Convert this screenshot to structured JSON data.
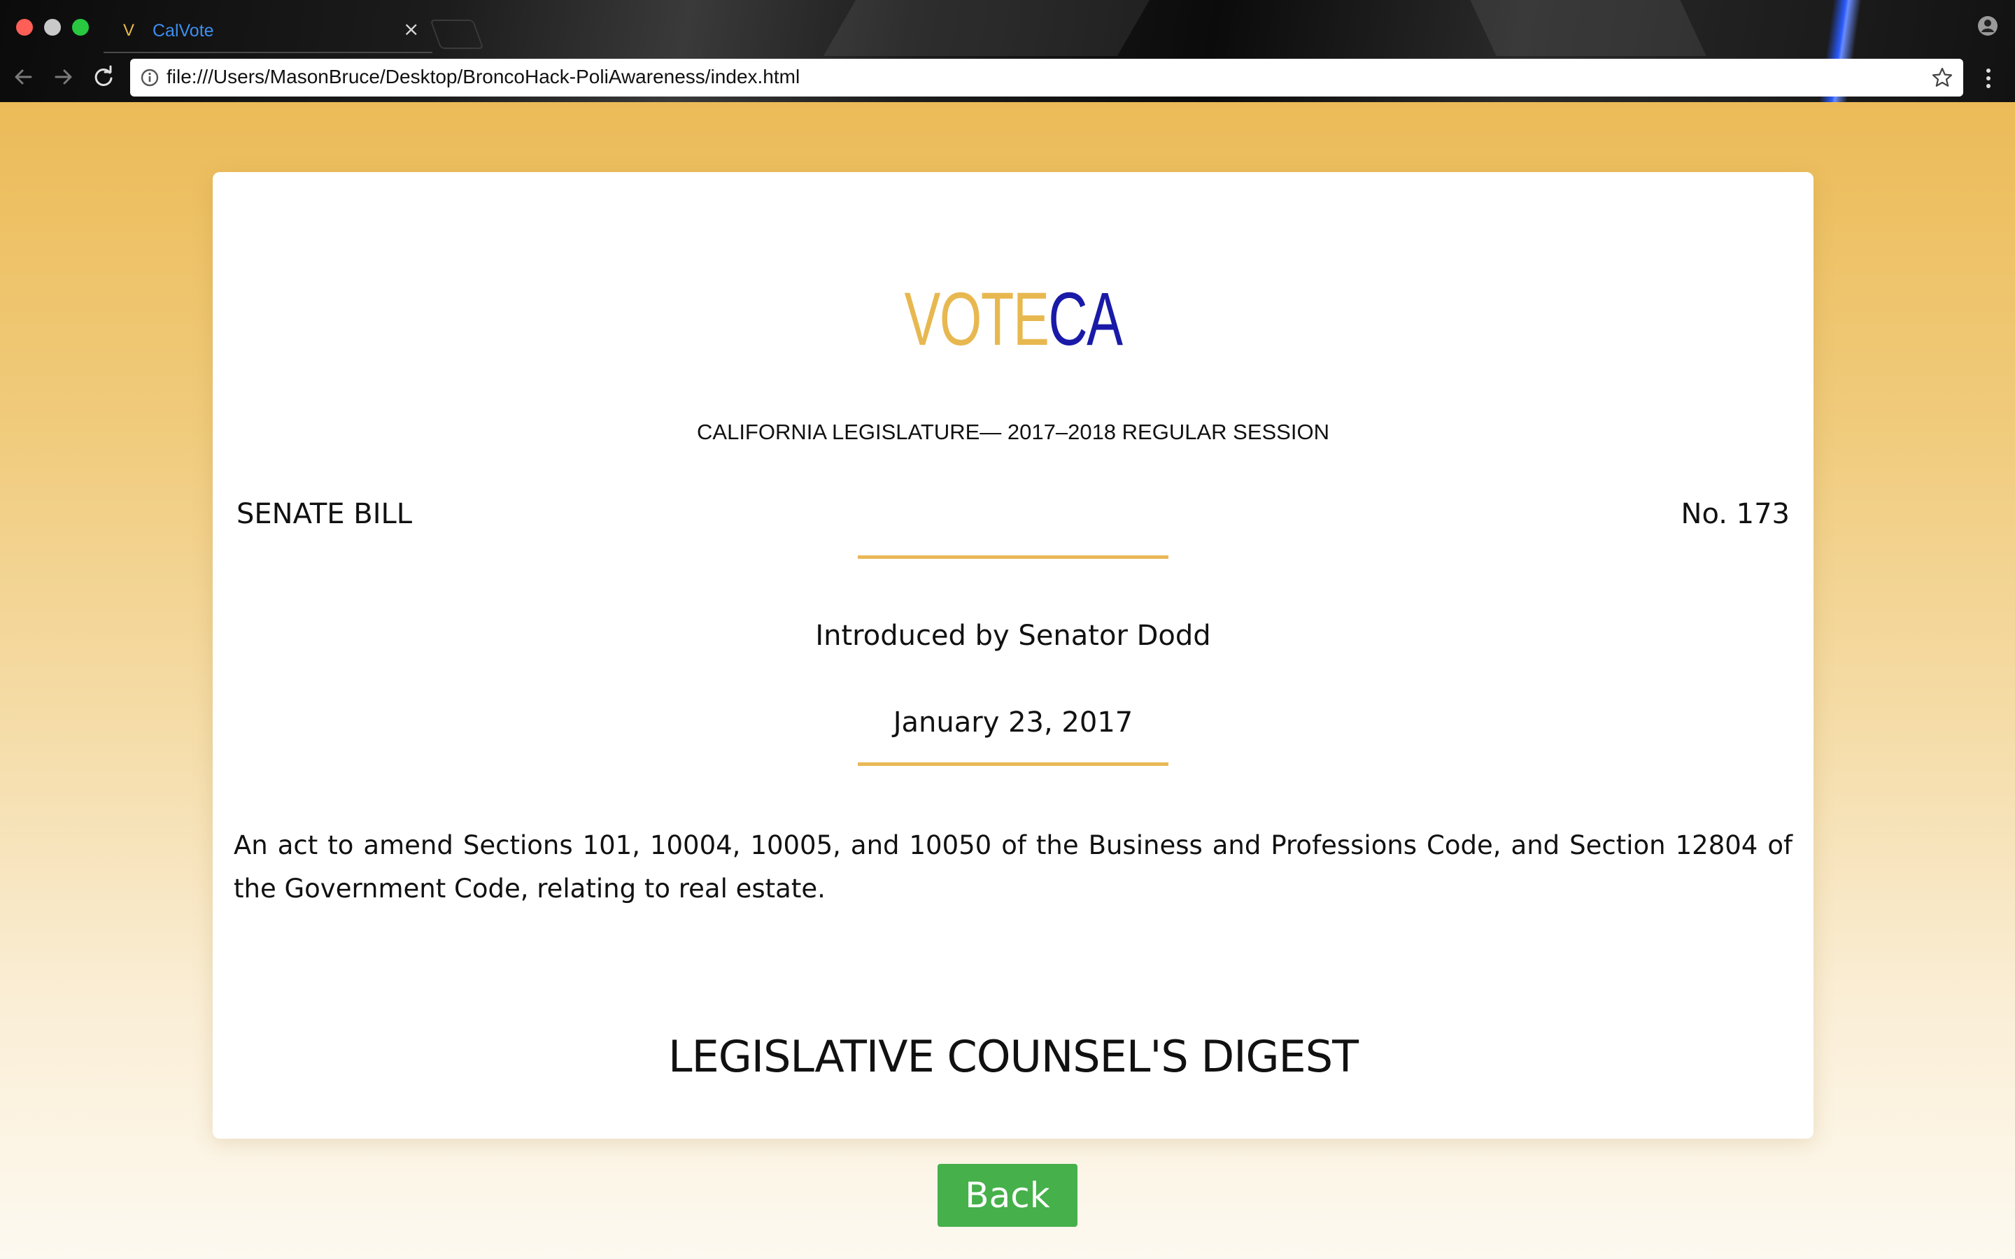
{
  "browser": {
    "tab": {
      "favicon_text": "V",
      "title": "CalVote",
      "close_glyph": "×"
    },
    "url": "file:///Users/MasonBruce/Desktop/BroncoHack-PoliAwareness/index.html",
    "icons": {
      "back": "arrow-left-icon",
      "forward": "arrow-right-icon",
      "reload": "reload-icon",
      "info": "info-icon",
      "bookmark": "star-icon",
      "menu": "kebab-menu-icon",
      "profile": "profile-icon"
    }
  },
  "logo": {
    "part1": "VOTE",
    "part2": "CA",
    "color1": "#e8b850",
    "color2": "#1a1aa8"
  },
  "bill": {
    "session": "CALIFORNIA LEGISLATURE— 2017–2018 REGULAR SESSION",
    "type": "SENATE BILL",
    "number": "No. 173",
    "introduced_by": "Introduced by Senator Dodd",
    "date": "January 23, 2017",
    "description": "An act to amend Sections 101, 10004, 10005, and 10050 of the Business and Professions Code, and Section 12804 of the Government Code, relating to real estate.",
    "digest_heading": "LEGISLATIVE COUNSEL'S DIGEST"
  },
  "actions": {
    "back_label": "Back"
  },
  "colors": {
    "accent_gold": "#e9b857",
    "back_button": "#46b04a",
    "tab_title": "#3d8ef0"
  }
}
